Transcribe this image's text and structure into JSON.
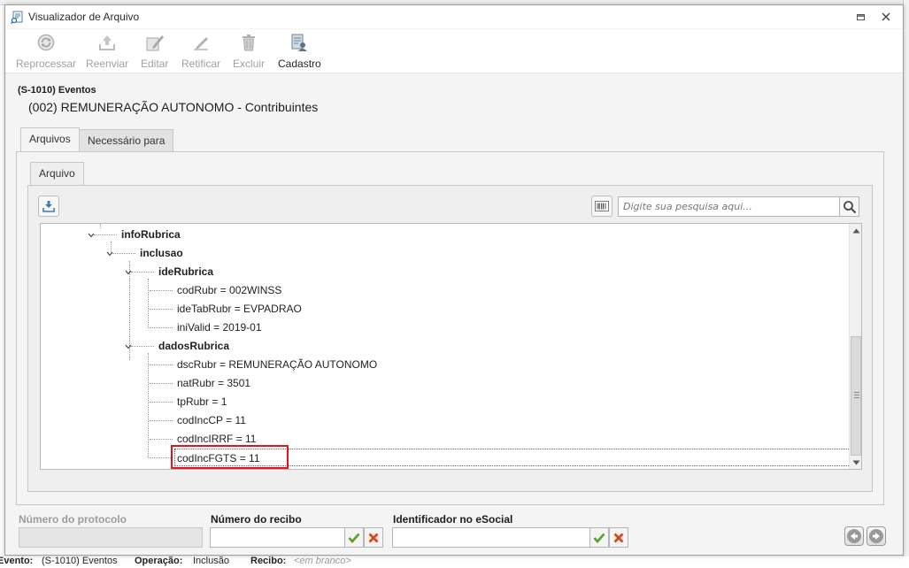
{
  "window": {
    "title": "Visualizador de Arquivo"
  },
  "toolbar": {
    "reprocess": "Reprocessar",
    "resend": "Reenviar",
    "edit": "Editar",
    "rectify": "Retificar",
    "delete": "Excluir",
    "register": "Cadastro"
  },
  "header": {
    "event_code": "(S-1010) Eventos",
    "event_desc": "(002) REMUNERAÇÃO AUTONOMO - Contribuintes"
  },
  "tabs": {
    "files": "Arquivos",
    "required_for": "Necessário para"
  },
  "inner_tab": "Arquivo",
  "search": {
    "placeholder": "Digite sua pesquisa aqui..."
  },
  "tree": {
    "info_rubrica": "infoRubrica",
    "inclusao": "inclusao",
    "ide_rubrica": "ideRubrica",
    "cod_rubr": "codRubr = 002WINSS",
    "ide_tab_rubr": "ideTabRubr = EVPADRAO",
    "ini_valid": "iniValid = 2019-01",
    "dados_rubrica": "dadosRubrica",
    "dsc_rubr": "dscRubr = REMUNERAÇÃO AUTONOMO",
    "nat_rubr": "natRubr = 3501",
    "tp_rubr": "tpRubr = 1",
    "cod_inc_cp": "codIncCP = 11",
    "cod_inc_irrf": "codIncIRRF = 11",
    "cod_inc_fgts": "codIncFGTS = 11"
  },
  "fields": {
    "protocol": {
      "label": "Número do protocolo",
      "value": ""
    },
    "receipt": {
      "label": "Número do recibo",
      "value": ""
    },
    "esocial_id": {
      "label": "Identificador no eSocial",
      "value": ""
    }
  },
  "behind_status": {
    "event_label": "Evento:",
    "event_value": "(S-1010) Eventos",
    "operation_label": "Operação:",
    "operation_value": "Inclusão",
    "receipt_label": "Recibo:",
    "receipt_value": "<em branco>"
  },
  "colors": {
    "highlight": "#e0141e",
    "confirm": "#5aa02c",
    "cancel": "#d9481c"
  }
}
